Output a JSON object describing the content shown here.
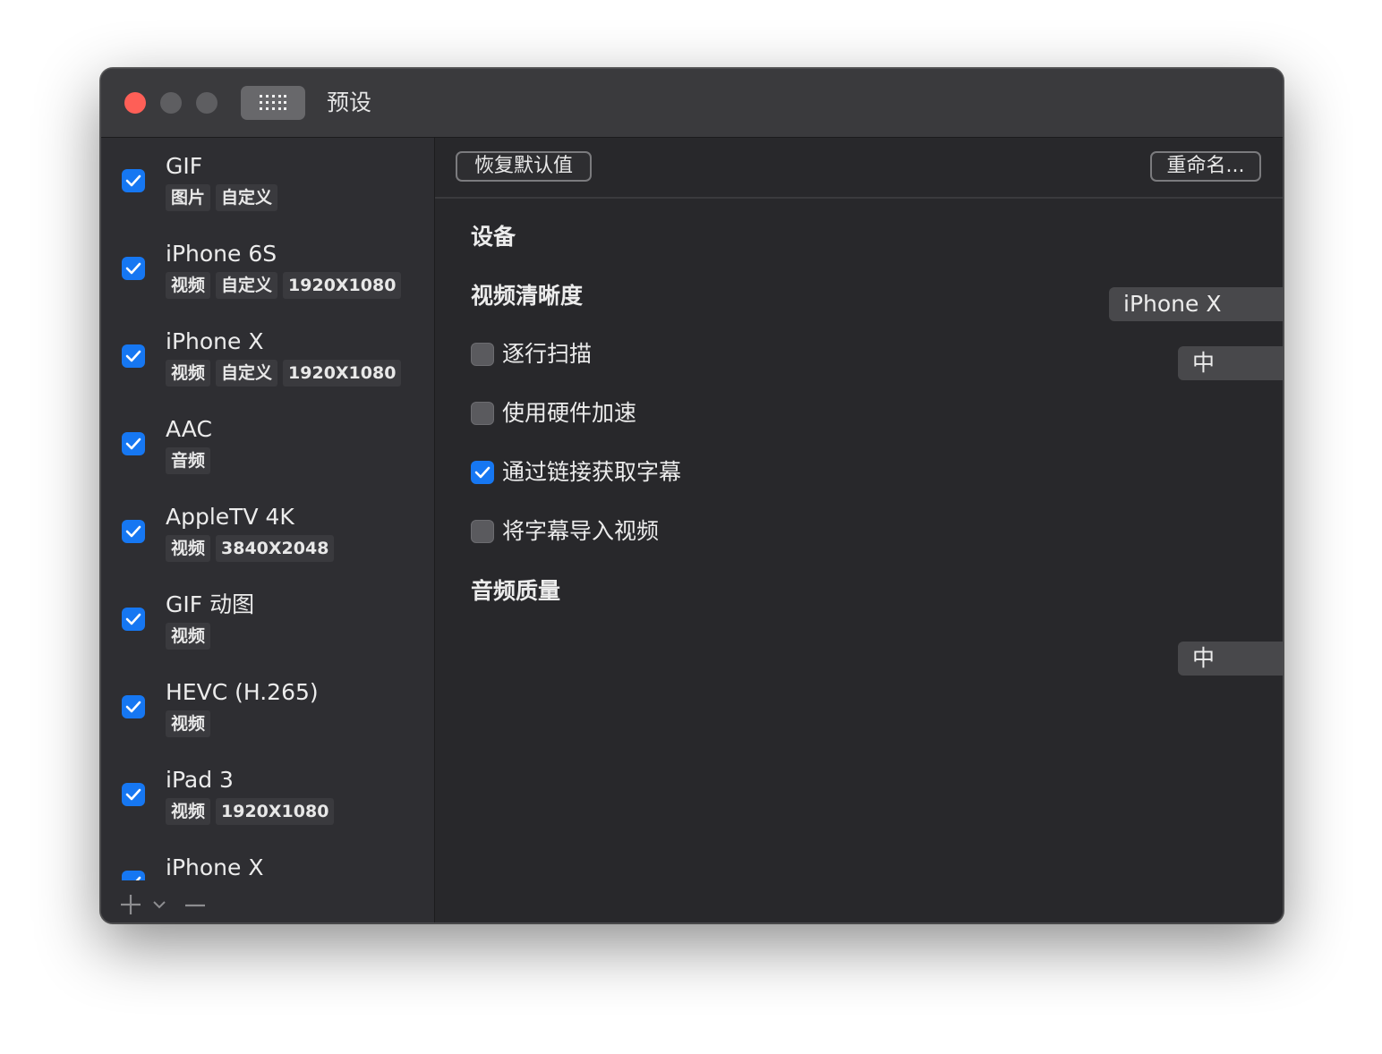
{
  "window": {
    "title": "预设"
  },
  "sidebar": {
    "items": [
      {
        "name": "GIF",
        "checked": true,
        "tags": [
          "图片",
          "自定义"
        ]
      },
      {
        "name": "iPhone 6S",
        "checked": true,
        "tags": [
          "视频",
          "自定义",
          "1920X1080"
        ]
      },
      {
        "name": "iPhone X",
        "checked": true,
        "tags": [
          "视频",
          "自定义",
          "1920X1080"
        ]
      },
      {
        "name": "AAC",
        "checked": true,
        "tags": [
          "音频"
        ]
      },
      {
        "name": "AppleTV 4K",
        "checked": true,
        "tags": [
          "视频",
          "3840X2048"
        ]
      },
      {
        "name": "GIF 动图",
        "checked": true,
        "tags": [
          "视频"
        ]
      },
      {
        "name": "HEVC (H.265)",
        "checked": true,
        "tags": [
          "视频"
        ]
      },
      {
        "name": "iPad 3",
        "checked": true,
        "tags": [
          "视频",
          "1920X1080"
        ]
      },
      {
        "name": "iPhone X",
        "checked": true,
        "tags": []
      }
    ],
    "footer": {
      "add": "+",
      "menu": "⌄",
      "remove": "—"
    }
  },
  "toolbar": {
    "restore_label": "恢复默认值",
    "rename_label": "重命名..."
  },
  "settings": {
    "device_label": "设备",
    "device_value": "iPhone X",
    "video_quality_label": "视频清晰度",
    "video_quality_value": "中",
    "progressive_label": "逐行扫描",
    "progressive_checked": false,
    "hw_accel_label": "使用硬件加速",
    "hw_accel_checked": false,
    "subs_link_label": "通过链接获取字幕",
    "subs_link_checked": true,
    "subs_import_label": "将字幕导入视频",
    "subs_import_checked": false,
    "audio_quality_label": "音频质量",
    "audio_quality_value": "中"
  },
  "colors": {
    "accent": "#1677f2",
    "close": "#fe5f57",
    "window_bg": "#2a2a2d"
  },
  "icons": [
    "close-button",
    "minimize-button",
    "zoom-button",
    "grid-icon",
    "checkmark-icon",
    "chevron-updown-icon",
    "plus-icon",
    "chevron-down-icon",
    "minus-icon"
  ]
}
